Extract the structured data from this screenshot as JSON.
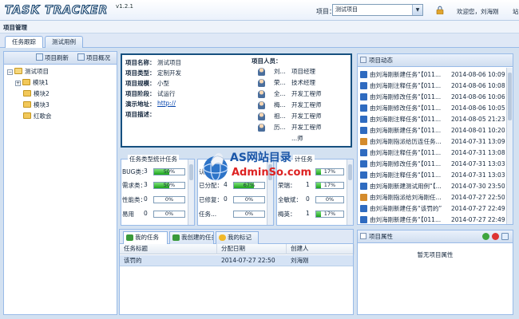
{
  "header": {
    "logo": "TASK TRACKER",
    "version": "v1.2.1",
    "project_label": "项目：",
    "project_selected": "测试项目",
    "welcome": "欢迎您，刘海刚",
    "extra": "站"
  },
  "page_title": "项目管理",
  "tabs": [
    {
      "label": "任务跟踪",
      "active": true
    },
    {
      "label": "测试用例",
      "active": false
    }
  ],
  "tree_toolbar": {
    "refresh": "项目刷新",
    "overview": "项目概况"
  },
  "tree": {
    "root": "测试项目",
    "children": [
      {
        "label": "模块1",
        "expandable": true
      },
      {
        "label": "模块2",
        "expandable": false
      },
      {
        "label": "模块3",
        "expandable": false
      },
      {
        "label": "红歌会",
        "expandable": false
      }
    ]
  },
  "project_info": {
    "fields": [
      {
        "key": "项目名称：",
        "value": "测试项目"
      },
      {
        "key": "项目类型：",
        "value": "定制开发"
      },
      {
        "key": "项目规模：",
        "value": "小型"
      },
      {
        "key": "项目阶段：",
        "value": "试运行"
      },
      {
        "key": "演示地址：",
        "value": "http://"
      },
      {
        "key": "项目描述：",
        "value": ""
      }
    ],
    "members_title": "项目人员：",
    "members": [
      {
        "name": "刘...",
        "role": "项目经理"
      },
      {
        "name": "荣...",
        "role": "技术经理"
      },
      {
        "name": "全...",
        "role": "开发工程师"
      },
      {
        "name": "梅...",
        "role": "开发工程师"
      },
      {
        "name": "祖...",
        "role": "开发工程师"
      },
      {
        "name": "历...",
        "role": "开发工程师"
      },
      {
        "name": "",
        "role": "...师"
      }
    ]
  },
  "stats_type": {
    "title": "任务类型统计任务",
    "rows": [
      {
        "label": "BUG类：",
        "count": "3",
        "pct": 50,
        "pct_label": "50%"
      },
      {
        "label": "需求类：",
        "count": "3",
        "pct": 50,
        "pct_label": "50%"
      },
      {
        "label": "性能类：",
        "count": "0",
        "pct": 0,
        "pct_label": "0%"
      },
      {
        "label": "易用",
        "count": "0",
        "pct": 0,
        "pct_label": "0%"
      }
    ]
  },
  "stats_status": {
    "rows": [
      {
        "label": "认：",
        "count": "",
        "pct": 0,
        "pct_label": ""
      },
      {
        "label": "已分配：",
        "count": "4",
        "pct": 67,
        "pct_label": "67%"
      },
      {
        "label": "已修复：",
        "count": "0",
        "pct": 0,
        "pct_label": "0%"
      },
      {
        "label": "任务...",
        "count": "",
        "pct": 0,
        "pct_label": "0%"
      }
    ]
  },
  "stats_third": {
    "title": "计任务",
    "rows": [
      {
        "label": "",
        "count": "",
        "pct": 17,
        "pct_label": "17%"
      },
      {
        "label": "荣瑞：",
        "count": "1",
        "pct": 17,
        "pct_label": "17%"
      },
      {
        "label": "全敏斌：",
        "count": "0",
        "pct": 0,
        "pct_label": "0%"
      },
      {
        "label": "梅英：",
        "count": "1",
        "pct": 17,
        "pct_label": "17%"
      }
    ]
  },
  "watermark": {
    "line1": "AS网站目录",
    "line2": "AdminSo.com"
  },
  "tasks_panel": {
    "tabs": [
      {
        "label": "我的任务",
        "active": true
      },
      {
        "label": "我创建的任务",
        "active": false
      },
      {
        "label": "我的标记",
        "active": false
      }
    ],
    "columns": [
      "任务标题",
      "分配日期",
      "创建人"
    ],
    "rows": [
      {
        "title": "该罚的",
        "date": "2014-07-27 22:50",
        "creator": "刘海刚"
      }
    ]
  },
  "activity": {
    "title": "项目动态",
    "items": [
      {
        "text": "由刘海刚新建任务“【011...",
        "date": "2014-08-06 10:09",
        "color": "#2f6bc0"
      },
      {
        "text": "由刘海刚注释任务“【011...",
        "date": "2014-08-06 10:08",
        "color": "#2f6bc0"
      },
      {
        "text": "由刘海刚修改任务“【011...",
        "date": "2014-08-06 10:06",
        "color": "#2f6bc0"
      },
      {
        "text": "由刘海刚修改任务“【011...",
        "date": "2014-08-06 10:05",
        "color": "#2f6bc0"
      },
      {
        "text": "由刘海刚注释任务“【011...",
        "date": "2014-08-05 21:23",
        "color": "#2f6bc0"
      },
      {
        "text": "由刘海刚新建任务“【011...",
        "date": "2014-08-01 10:20",
        "color": "#2f6bc0"
      },
      {
        "text": "由刘海刚指派给历连任务...",
        "date": "2014-07-31 13:09",
        "color": "#d48b2c"
      },
      {
        "text": "由刘海刚注释任务“【011...",
        "date": "2014-07-31 13:08",
        "color": "#2f6bc0"
      },
      {
        "text": "由刘海刚修改任务“【011...",
        "date": "2014-07-31 13:03",
        "color": "#2f6bc0"
      },
      {
        "text": "由刘海刚注释任务“【011...",
        "date": "2014-07-31 13:03",
        "color": "#2f6bc0"
      },
      {
        "text": "由刘海刚新建测试用例“【...",
        "date": "2014-07-30 23:50",
        "color": "#2f6bc0"
      },
      {
        "text": "由刘海刚指派给刘海刚任...",
        "date": "2014-07-27 22:50",
        "color": "#d48b2c"
      },
      {
        "text": "由刘海刚新建任务“该罚的”",
        "date": "2014-07-27 22:49",
        "color": "#2f6bc0"
      },
      {
        "text": "由刘海刚新建任务“【011...",
        "date": "2014-07-27 22:49",
        "color": "#2f6bc0"
      }
    ]
  },
  "properties": {
    "title": "项目属性",
    "empty_text": "暂无项目属性"
  }
}
